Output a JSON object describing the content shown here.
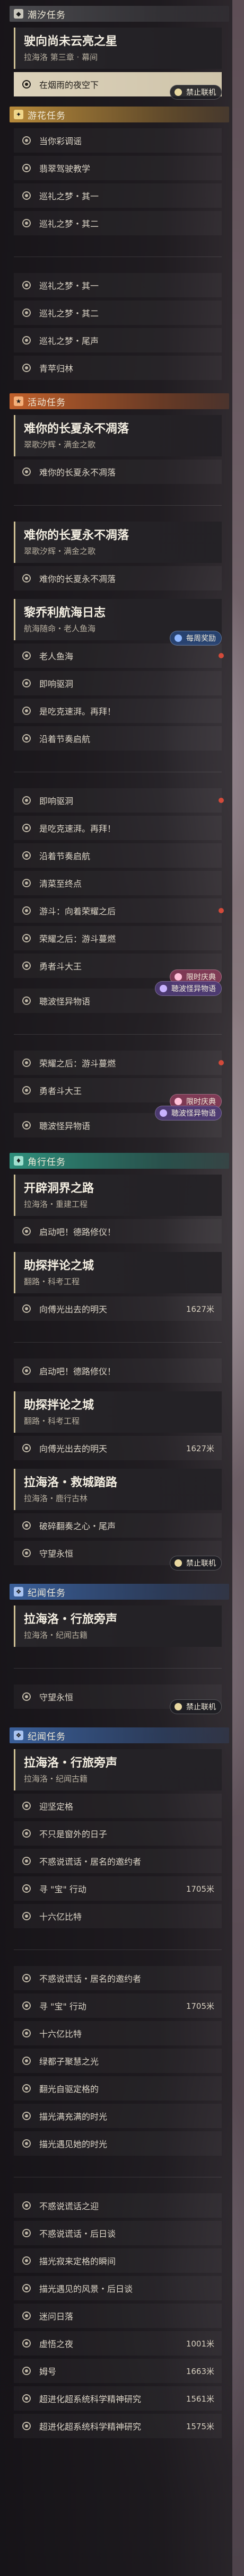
{
  "sections": {
    "s1_header": "潮汐任务",
    "s1_card": {
      "title": "驶向尚未云亮之星",
      "sub": "拉海洛 第三章 · 幕间"
    },
    "s1_active_row": "在烟雨的夜空下",
    "s1_badge": "禁止联机",
    "s2_header": "游花任务",
    "s2_rows": [
      "当你彩调谣",
      "翡翠驾驶教学",
      "巡礼之梦・其一",
      "巡礼之梦・其二"
    ],
    "s2_rows_b": [
      "巡礼之梦・其一",
      "巡礼之梦・其二",
      "巡礼之梦・尾声",
      "青苹归林"
    ],
    "s3_header": "活动任务",
    "s3_card": {
      "title": "难你的长夏永不凋落",
      "sub": "翠歌汐辉・满金之歌"
    },
    "s3_row": "难你的长夏永不凋落",
    "s3_card2": {
      "title": "难你的长夏永不凋落",
      "sub": "翠歌汐辉・满金之歌"
    },
    "s3_row2": "难你的长夏永不凋落",
    "s4_card": {
      "title": "黎乔利航海日志",
      "sub": "航海随命・老人鱼海"
    },
    "s4_badge": "每周奖励",
    "s4_rows": [
      "老人鱼海",
      "即响驱洞",
      "是吃克速湃。再拜！",
      "沿着节奏启航"
    ],
    "s4_rows_b": [
      "即响驱洞",
      "是吃克速湃。再拜！",
      "沿着节奏启航",
      "清菜至终点",
      "游斗：向着荣耀之后",
      "荣耀之后：游斗蔓燃",
      "勇者斗大王"
    ],
    "s4_badge2": "限时庆典",
    "s4_row_last": "聴波怪异物语",
    "s4_badge3": "聴波怪异物语",
    "s4_rows_c": [
      "荣耀之后：游斗蔓燃",
      "勇者斗大王",
      "聴波怪异物语"
    ],
    "s4_badge4": "限时庆典",
    "s4_badge5": "聴波怪异物语",
    "s5_header": "角行任务",
    "s5_card": {
      "title": "开辟洞界之路",
      "sub": "拉海洛・重建工程"
    },
    "s5_row": "启动吧！德路修仪！",
    "s5_card2": {
      "title": "助探拌论之城",
      "sub": "翻路・科考工程"
    },
    "s5_row2": {
      "label": "向傅光出去的明天",
      "dist": "1627米"
    },
    "s5_row3": "启动吧！德路修仪！",
    "s5_card3": {
      "title": "助探拌论之城",
      "sub": "翻路・科考工程"
    },
    "s5_row4": {
      "label": "向傅光出去的明天",
      "dist": "1627米"
    },
    "s5_card4": {
      "title": "拉海洛・救城踏路",
      "sub": "拉海洛・鹿行古林"
    },
    "s5_rows5": [
      "破碎翻奏之心・尾声",
      "守望永恒"
    ],
    "s5_badge": "禁止联机",
    "s6_header": "纪闻任务",
    "s6_card": {
      "title": "拉海洛・行旅旁声",
      "sub": "拉海洛・纪闻古籍"
    },
    "s6_row": "守望永恒",
    "s6_badge": "禁止联机",
    "s6_header2": "纪闻任务",
    "s6_card2": {
      "title": "拉海洛・行旅旁声",
      "sub": "拉海洛・纪闻古籍"
    },
    "s6_rows": [
      {
        "label": "迎坚定格",
        "dist": ""
      },
      {
        "label": "不只是窗外的日子",
        "dist": ""
      },
      {
        "label": "不惑说谎话・居名的邀约者",
        "dist": ""
      },
      {
        "label": "寻 \"宝\" 行动",
        "dist": "1705米"
      },
      {
        "label": "十六亿比特",
        "dist": ""
      }
    ],
    "s6_rows_b": [
      {
        "label": "不惑说谎话・居名的邀约者",
        "dist": ""
      },
      {
        "label": "寻 \"宝\" 行动",
        "dist": "1705米"
      },
      {
        "label": "十六亿比特",
        "dist": ""
      },
      {
        "label": "绿都子聚慧之光",
        "dist": ""
      },
      {
        "label": "翻光自驱定格的",
        "dist": ""
      },
      {
        "label": "描光满充满的时光",
        "dist": ""
      },
      {
        "label": "描光遇见她的时光",
        "dist": ""
      }
    ],
    "s6_rows_c": [
      {
        "label": "不惑说谎话之迎",
        "dist": ""
      },
      {
        "label": "不惑说谎话・后日谈",
        "dist": ""
      },
      {
        "label": "描光寂来定格的瞬间",
        "dist": ""
      },
      {
        "label": "描光遇见的风景・后日谈",
        "dist": ""
      },
      {
        "label": "迷问日落",
        "dist": ""
      },
      {
        "label": "虚悟之夜",
        "dist": "1001米"
      },
      {
        "label": "姆号",
        "dist": "1663米"
      },
      {
        "label": "超进化超系统科学精神研究",
        "dist": "1561米"
      },
      {
        "label": "超进化超系统科学精神研究",
        "dist": "1575米"
      }
    ]
  }
}
